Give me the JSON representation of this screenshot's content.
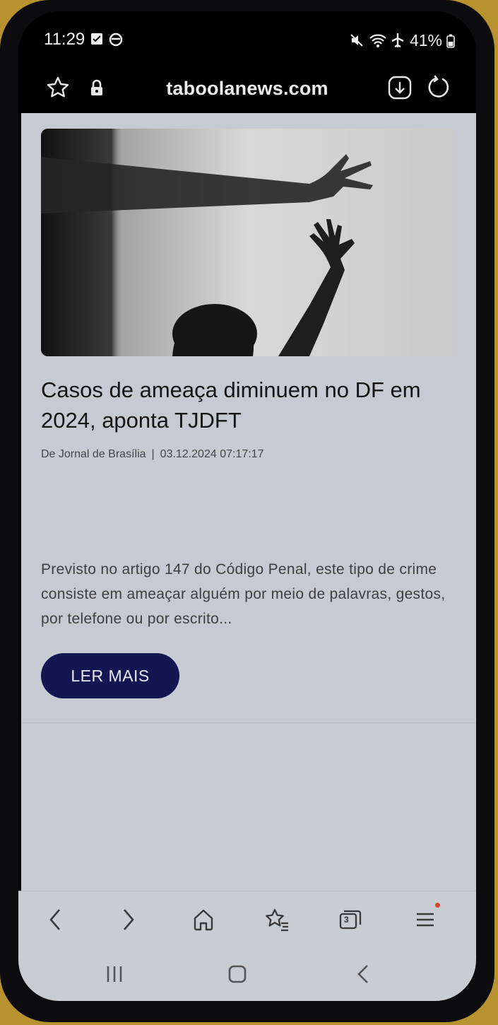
{
  "status_bar": {
    "time": "11:29",
    "battery": "41%"
  },
  "browser": {
    "url": "taboolanews.com"
  },
  "article": {
    "title": "Casos de ameaça diminuem no DF em 2024, aponta TJDFT",
    "source": "De Jornal de Brasília",
    "separator": "|",
    "date": "03.12.2024 07:17:17",
    "excerpt": "Previsto no artigo 147 do Código Penal, este tipo de crime consiste em ameaçar alguém por meio de palavras, gestos, por telefone ou por escrito...",
    "cta_label": "LER MAIS"
  },
  "toolbar": {
    "tab_count": "3"
  },
  "icons": {
    "status": [
      "checkbox-icon",
      "circle-app-icon",
      "mute-icon",
      "wifi-icon",
      "airplane-icon",
      "battery-icon"
    ],
    "address": [
      "star-icon",
      "lock-icon",
      "download-icon",
      "reload-icon"
    ],
    "toolbar": [
      "back-icon",
      "forward-icon",
      "home-icon",
      "bookmarks-icon",
      "tabs-icon",
      "menu-icon"
    ],
    "navbar": [
      "recents-icon",
      "home-nav-icon",
      "back-nav-icon"
    ]
  },
  "colors": {
    "page_background": "#c5cad3",
    "cta_background": "#131650",
    "notification_dot": "#d9452b"
  }
}
